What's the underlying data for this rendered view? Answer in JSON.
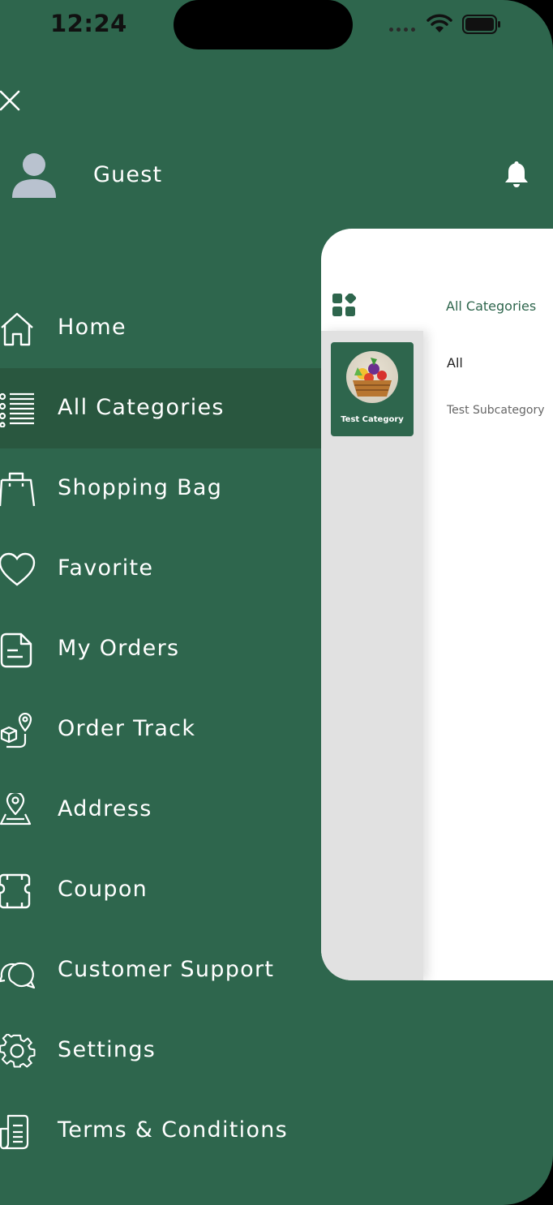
{
  "status_bar": {
    "time": "12:24"
  },
  "drawer": {
    "user_name": "Guest",
    "menu": [
      {
        "label": "Home",
        "icon": "home-icon"
      },
      {
        "label": "All Categories",
        "icon": "list-icon",
        "active": true
      },
      {
        "label": "Shopping Bag",
        "icon": "bag-icon"
      },
      {
        "label": "Favorite",
        "icon": "heart-icon"
      },
      {
        "label": "My Orders",
        "icon": "orders-icon"
      },
      {
        "label": "Order Track",
        "icon": "order-track-icon"
      },
      {
        "label": "Address",
        "icon": "location-icon"
      },
      {
        "label": "Coupon",
        "icon": "coupon-icon"
      },
      {
        "label": "Customer Support",
        "icon": "chat-icon"
      },
      {
        "label": "Settings",
        "icon": "gear-icon"
      },
      {
        "label": "Terms & Conditions",
        "icon": "document-icon"
      }
    ]
  },
  "preview": {
    "title": "All Categories",
    "category": {
      "label": "Test Category"
    },
    "subcategories": [
      "All",
      "Test Subcategory"
    ]
  },
  "colors": {
    "primary": "#2e664d",
    "active_row": "#29573f",
    "rail": "#e1e1e1"
  }
}
